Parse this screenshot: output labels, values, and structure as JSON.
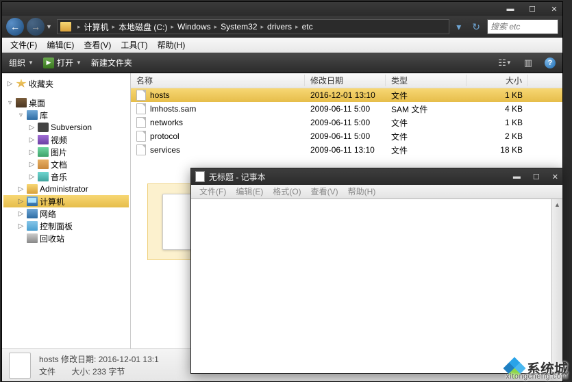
{
  "explorer": {
    "breadcrumb": [
      "计算机",
      "本地磁盘 (C:)",
      "Windows",
      "System32",
      "drivers",
      "etc"
    ],
    "search_placeholder": "搜索 etc",
    "menubar": [
      {
        "label": "文件(F)"
      },
      {
        "label": "编辑(E)"
      },
      {
        "label": "查看(V)"
      },
      {
        "label": "工具(T)"
      },
      {
        "label": "帮助(H)"
      }
    ],
    "toolbar": {
      "organize": "组织",
      "open": "打开",
      "new_folder": "新建文件夹"
    },
    "columns": {
      "name": "名称",
      "date": "修改日期",
      "type": "类型",
      "size": "大小"
    },
    "tree": {
      "favorites": "收藏夹",
      "desktop": "桌面",
      "library": "库",
      "subversion": "Subversion",
      "video": "视频",
      "pictures": "图片",
      "documents": "文档",
      "music": "音乐",
      "administrator": "Administrator",
      "computer": "计算机",
      "network": "网络",
      "control_panel": "控制面板",
      "recycle": "回收站"
    },
    "files": [
      {
        "name": "hosts",
        "date": "2016-12-01 13:10",
        "type": "文件",
        "size": "1 KB",
        "selected": true
      },
      {
        "name": "lmhosts.sam",
        "date": "2009-06-11 5:00",
        "type": "SAM 文件",
        "size": "4 KB",
        "selected": false
      },
      {
        "name": "networks",
        "date": "2009-06-11 5:00",
        "type": "文件",
        "size": "1 KB",
        "selected": false
      },
      {
        "name": "protocol",
        "date": "2009-06-11 5:00",
        "type": "文件",
        "size": "2 KB",
        "selected": false
      },
      {
        "name": "services",
        "date": "2009-06-11 13:10",
        "type": "文件",
        "size": "18 KB",
        "selected": false
      }
    ],
    "status": {
      "line1_prefix": "hosts 修改日期:",
      "line1_value": "2016-12-01 13:1",
      "line2_prefix": "文件",
      "line2_label": "大小:",
      "line2_value": "233 字节"
    }
  },
  "notepad": {
    "title": "无标题 - 记事本",
    "menubar": [
      {
        "label": "文件(F)"
      },
      {
        "label": "编辑(E)"
      },
      {
        "label": "格式(O)"
      },
      {
        "label": "查看(V)"
      },
      {
        "label": "帮助(H)"
      }
    ]
  },
  "watermark": {
    "text": "系统城",
    "url": "xitongcheng.com"
  }
}
